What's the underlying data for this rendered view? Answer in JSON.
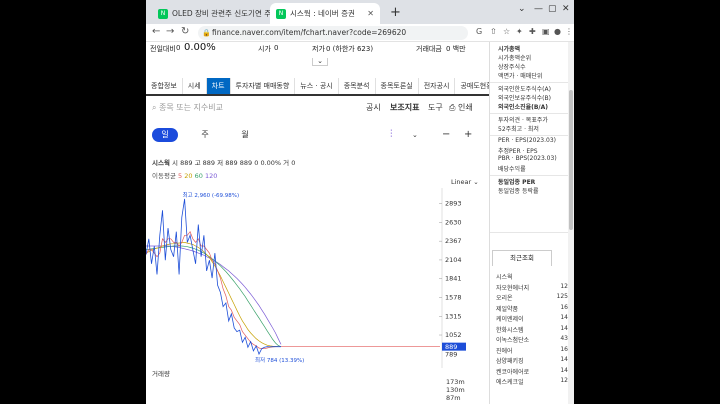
{
  "browser": {
    "tabs": [
      {
        "title": "OLED 장비 관련주 신도기연 주"
      },
      {
        "title": "시스웍 : 네이버 증권"
      }
    ],
    "url": "finance.naver.com/item/fchart.naver?code=269620"
  },
  "stockbar": {
    "label": "전일대비",
    "change_num": "0",
    "change_pct": "0.00%",
    "open_label": "시가",
    "open_val": "0",
    "low_label": "저가",
    "low_val": "0 (하한가 623)",
    "amount_label": "거래대금",
    "amount_val": "0 백만"
  },
  "menu": [
    "종합정보",
    "시세",
    "차트",
    "투자자별 매매동향",
    "뉴스 · 공시",
    "종목분석",
    "종목토론실",
    "전자공시",
    "공매도현황"
  ],
  "toolbar": {
    "search_placeholder": "종목 또는 지수비교",
    "notice": "공시",
    "indicator": "보조지표",
    "tools": "도구",
    "print": "인쇄"
  },
  "periods": [
    "일",
    "주",
    "월"
  ],
  "ohlc": {
    "name": "시스웍",
    "open_label": "시",
    "open": "889",
    "high_label": "고",
    "high": "889",
    "low_label": "저",
    "low": "889",
    "close": "889",
    "change": "0",
    "change_pct": "0.00%",
    "vol_label": "거",
    "vol": "0"
  },
  "ma": {
    "label": "이동평균",
    "periods": [
      "5",
      "20",
      "60",
      "120"
    ]
  },
  "scale_label": "Linear",
  "chart_data": {
    "type": "line",
    "title": "",
    "y_ticks": [
      2893,
      2630,
      2367,
      2104,
      1841,
      1578,
      1315,
      1052
    ],
    "last_price": "889",
    "below_price": "789",
    "ylim": [
      730,
      3000
    ],
    "high_annotation": "최고 2,960 (-69.98%)",
    "low_annotation": "최저 784 (13.39%)",
    "price_path": [
      2180,
      2400,
      2050,
      2300,
      1900,
      2450,
      2800,
      2100,
      2550,
      2250,
      2150,
      2500,
      1900,
      2700,
      2960,
      2350,
      2450,
      2250,
      2050,
      2600,
      2150,
      2450,
      1950,
      2100,
      1850,
      2200,
      1750,
      1650,
      1450,
      1500,
      1250,
      1350,
      1150,
      1100,
      1120,
      950,
      1020,
      880,
      960,
      830,
      900,
      784,
      860,
      880,
      890,
      885,
      888,
      889,
      889,
      889
    ],
    "ma_paths": {
      "ma5": [
        2180,
        2250,
        2250,
        2200,
        2150,
        2200,
        2400,
        2350,
        2400,
        2400,
        2350,
        2350,
        2300,
        2350,
        2450,
        2450,
        2500,
        2400,
        2350,
        2400,
        2300,
        2300,
        2250,
        2200,
        2100,
        2050,
        1950,
        1850,
        1700,
        1600,
        1450,
        1400,
        1300,
        1250,
        1200,
        1100,
        1050,
        1000,
        950,
        920,
        900,
        870,
        860,
        860,
        870,
        880,
        885,
        888,
        889,
        889
      ],
      "ma20": [
        2200,
        2220,
        2240,
        2260,
        2270,
        2280,
        2300,
        2310,
        2320,
        2330,
        2330,
        2340,
        2340,
        2350,
        2350,
        2340,
        2330,
        2320,
        2300,
        2280,
        2250,
        2220,
        2180,
        2140,
        2080,
        2020,
        1950,
        1880,
        1800,
        1720,
        1640,
        1560,
        1480,
        1400,
        1320,
        1250,
        1190,
        1130,
        1080,
        1040,
        1000,
        970,
        945,
        925,
        910,
        900,
        895,
        892,
        890,
        889
      ],
      "ma60": [
        2250,
        2255,
        2260,
        2265,
        2270,
        2275,
        2280,
        2285,
        2290,
        2295,
        2300,
        2300,
        2300,
        2300,
        2295,
        2290,
        2280,
        2270,
        2255,
        2240,
        2220,
        2200,
        2175,
        2150,
        2120,
        2090,
        2055,
        2020,
        1980,
        1940,
        1895,
        1850,
        1800,
        1750,
        1700,
        1645,
        1590,
        1530,
        1470,
        1410,
        1350,
        1290,
        1230,
        1170,
        1110,
        1050,
        990,
        940,
        905,
        889
      ],
      "ma120": [
        2300,
        2300,
        2300,
        2300,
        2300,
        2300,
        2300,
        2300,
        2300,
        2295,
        2290,
        2285,
        2280,
        2270,
        2260,
        2250,
        2240,
        2230,
        2215,
        2200,
        2185,
        2170,
        2150,
        2130,
        2110,
        2090,
        2065,
        2040,
        2010,
        1980,
        1950,
        1915,
        1880,
        1845,
        1805,
        1765,
        1720,
        1675,
        1625,
        1575,
        1520,
        1465,
        1405,
        1345,
        1280,
        1215,
        1150,
        1080,
        1000,
        920
      ]
    },
    "volume_label": "거래량",
    "volume_ticks": [
      "173m",
      "130m",
      "87m"
    ]
  },
  "colors": {
    "price": "#1d4ed8",
    "ma5": "#e25a5a",
    "ma20": "#c6a000",
    "ma60": "#38a169",
    "ma120": "#7b5bd6",
    "active_tab": "#0068c3",
    "price_tag": "#1d4ed8"
  },
  "rpanel": {
    "items1": [
      "시가총액",
      "시가총액순위",
      "상장주식수",
      "액면가 · 매매단위"
    ],
    "items2": [
      "외국인한도주식수(A)",
      "외국인보유주식수(B)",
      "외국인소진율(B/A)"
    ],
    "items3": [
      "투자의견 · 목표주가",
      "52주최고 · 최저"
    ],
    "items4": [
      "PER · EPS(2023.03)",
      "추정PER · EPS",
      "PBR · BPS(2023.03)",
      "배당수익률"
    ],
    "items5": [
      "동일업종 PER",
      "동일업종 등락률"
    ],
    "recent_header": "최근조회",
    "recent": [
      {
        "name": "시스웍",
        "val": ""
      },
      {
        "name": "자오현에너지",
        "val": "12"
      },
      {
        "name": "오리온",
        "val": "125"
      },
      {
        "name": "제일약품",
        "val": "16"
      },
      {
        "name": "케이엔제이",
        "val": "14"
      },
      {
        "name": "한화시스템",
        "val": "14"
      },
      {
        "name": "이녹스첨단소",
        "val": "43"
      },
      {
        "name": "진에어",
        "val": "16"
      },
      {
        "name": "삼양패키징",
        "val": "14"
      },
      {
        "name": "켄코아에어로",
        "val": "14"
      },
      {
        "name": "에스케크일",
        "val": "12"
      }
    ]
  }
}
